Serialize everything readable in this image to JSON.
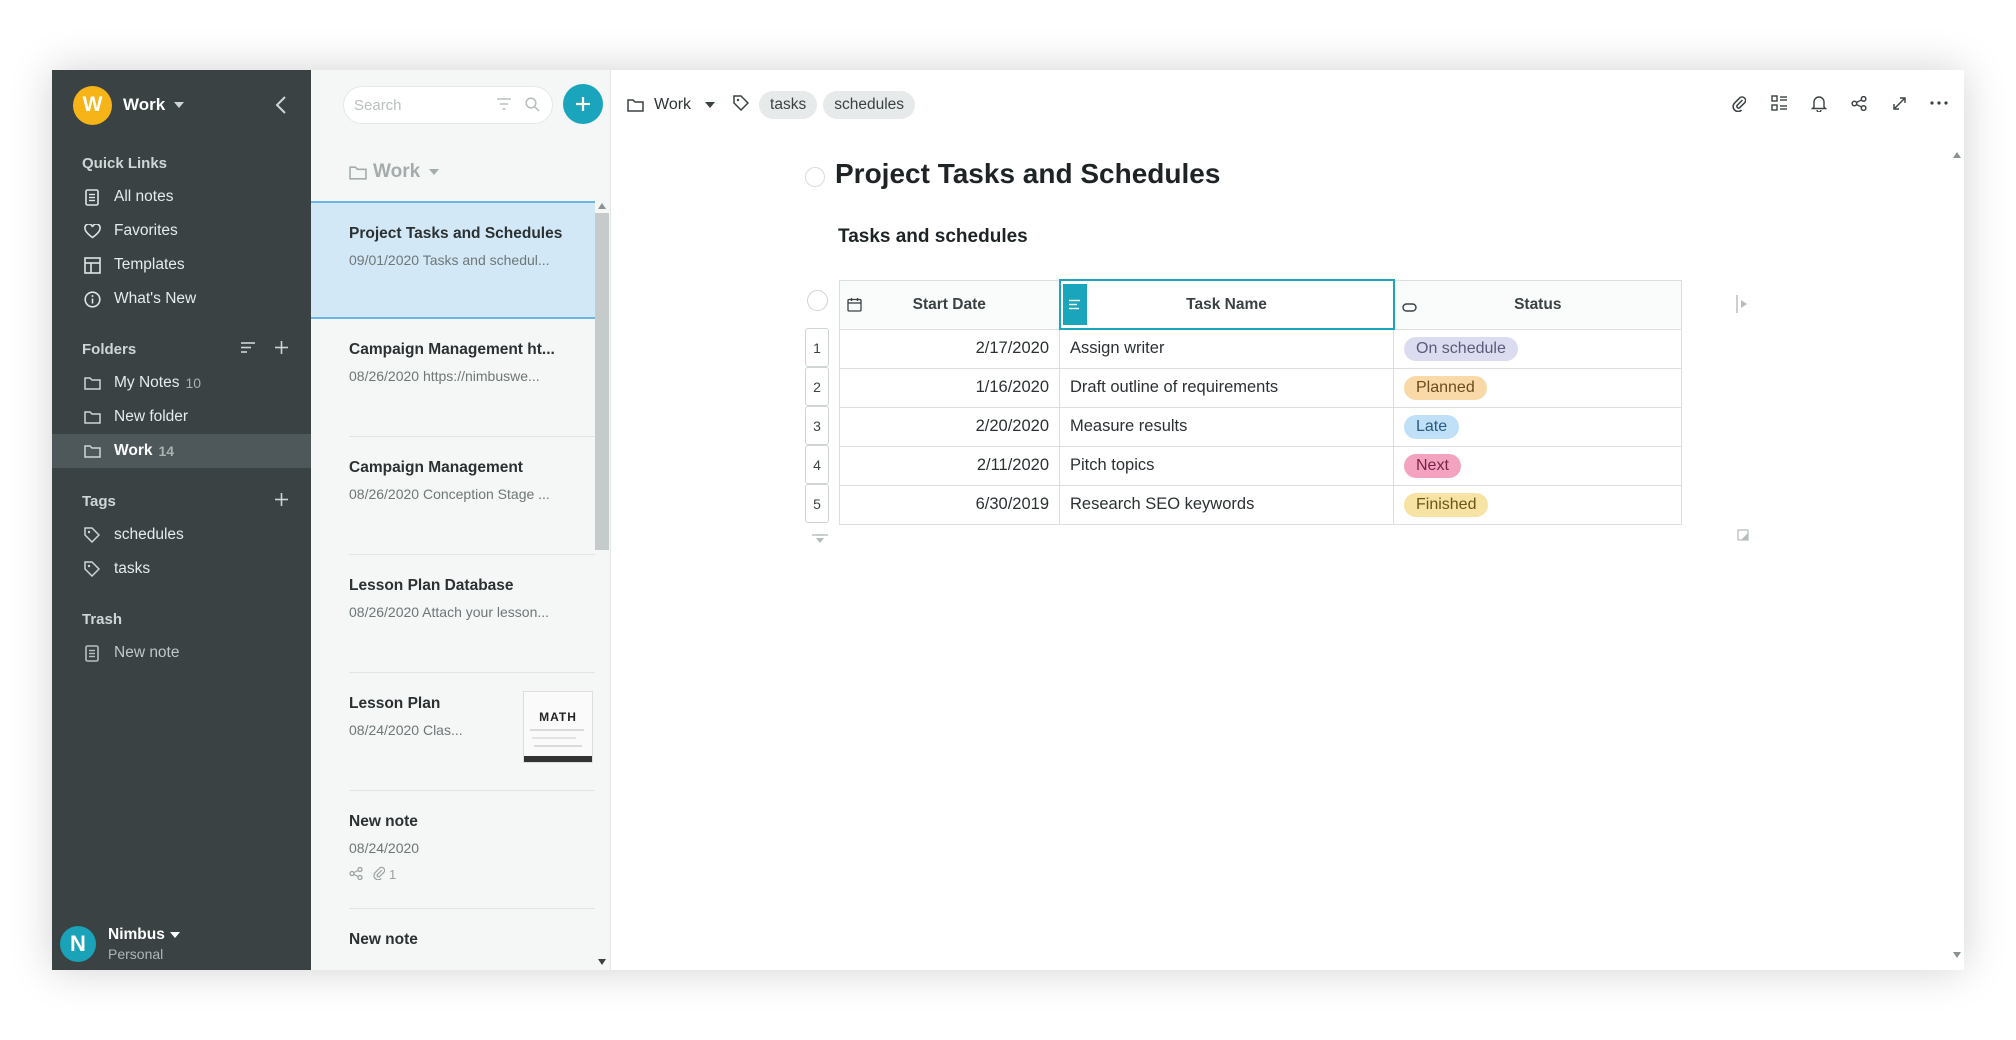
{
  "workspace": {
    "initial": "W",
    "name": "Work"
  },
  "sidebar": {
    "quick_links_title": "Quick Links",
    "quick_links": [
      {
        "label": "All notes",
        "icon": "note-icon"
      },
      {
        "label": "Favorites",
        "icon": "heart-icon"
      },
      {
        "label": "Templates",
        "icon": "templates-icon"
      },
      {
        "label": "What's New",
        "icon": "info-icon"
      }
    ],
    "folders_title": "Folders",
    "folders": [
      {
        "label": "My Notes",
        "count": "10"
      },
      {
        "label": "New folder",
        "count": ""
      },
      {
        "label": "Work",
        "count": "14"
      }
    ],
    "tags_title": "Tags",
    "tags": [
      {
        "label": "schedules"
      },
      {
        "label": "tasks"
      }
    ],
    "trash_title": "Trash",
    "trash_items": [
      {
        "label": "New note"
      }
    ],
    "user": {
      "initial": "N",
      "name": "Nimbus",
      "sub": "Personal"
    }
  },
  "notelist": {
    "search_placeholder": "Search",
    "folder_title": "Work",
    "notes": [
      {
        "title": "Project Tasks and Schedules",
        "sub": "09/01/2020 Tasks and schedul..."
      },
      {
        "title": "Campaign Management ht...",
        "sub": "08/26/2020 https://nimbuswe..."
      },
      {
        "title": "Campaign Management",
        "sub": "08/26/2020 Conception Stage ..."
      },
      {
        "title": "Lesson Plan Database",
        "sub": "08/26/2020 Attach your lesson..."
      },
      {
        "title": "Lesson Plan",
        "sub": "08/24/2020 Clas...",
        "thumb_text": "MATH"
      },
      {
        "title": "New note",
        "sub": "08/24/2020",
        "attach_count": "1"
      },
      {
        "title": "New note",
        "sub": ""
      }
    ]
  },
  "main": {
    "breadcrumb_folder": "Work",
    "tags": [
      "tasks",
      "schedules"
    ],
    "title": "Project Tasks and Schedules",
    "section_heading": "Tasks and schedules",
    "table": {
      "headers": [
        "Start Date",
        "Task Name",
        "Status"
      ],
      "rows": [
        {
          "num": "1",
          "date": "2/17/2020",
          "task": "Assign writer",
          "status": "On schedule",
          "color": "#dcdcf0",
          "text": "#5a5a7a"
        },
        {
          "num": "2",
          "date": "1/16/2020",
          "task": "Draft outline of requirements",
          "status": "Planned",
          "color": "#fad9a8",
          "text": "#6b4b1e"
        },
        {
          "num": "3",
          "date": "2/20/2020",
          "task": "Measure results",
          "status": "Late",
          "color": "#bfe0f7",
          "text": "#2a5a80"
        },
        {
          "num": "4",
          "date": "2/11/2020",
          "task": "Pitch topics",
          "status": "Next",
          "color": "#f3a3bf",
          "text": "#7a2348"
        },
        {
          "num": "5",
          "date": "6/30/2019",
          "task": "Research SEO keywords",
          "status": "Finished",
          "color": "#f7e3a3",
          "text": "#6b5418"
        }
      ]
    }
  },
  "colors": {
    "accent": "#1aa5bd",
    "sidebar": "#3a4244",
    "workspace_avatar": "#f6b418"
  }
}
